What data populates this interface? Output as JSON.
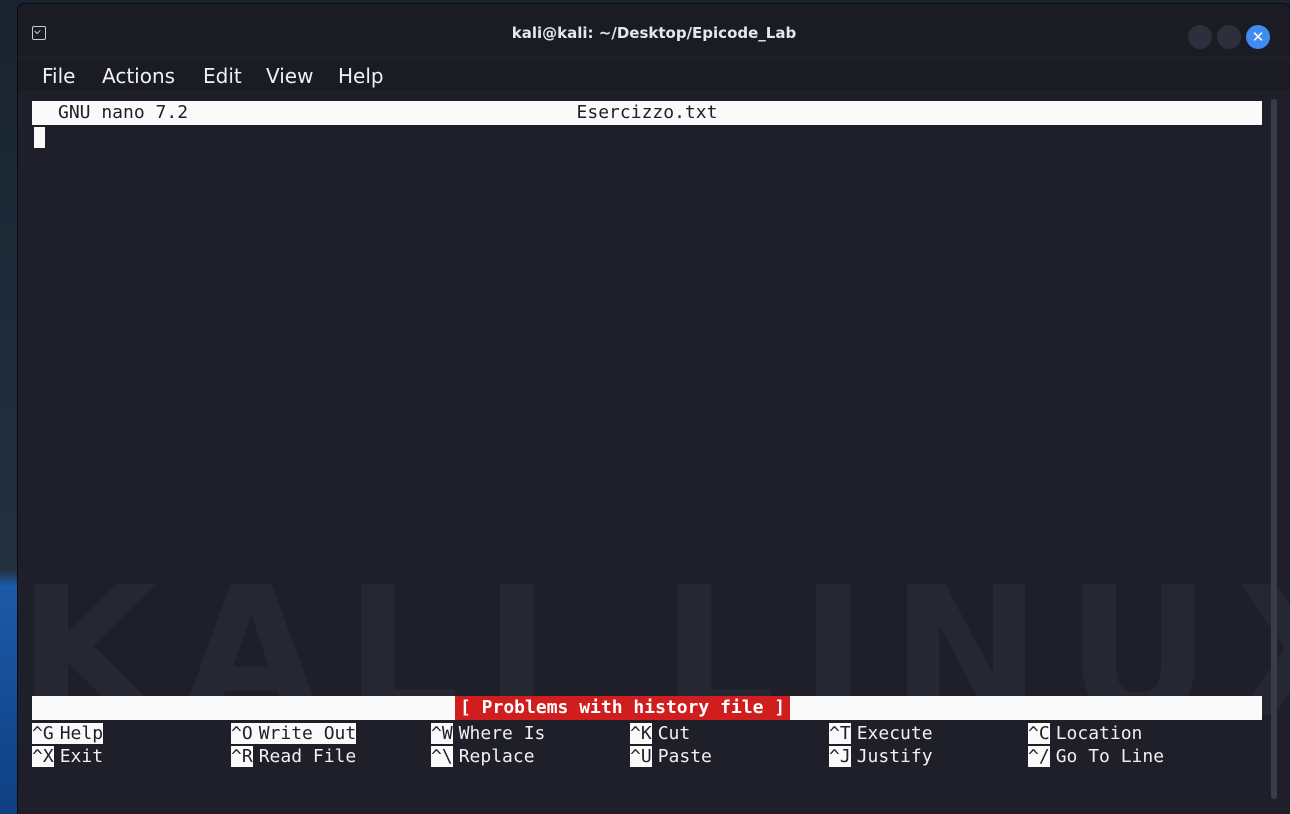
{
  "window": {
    "title": "kali@kali: ~/Desktop/Epicode_Lab",
    "close_symbol": "✕"
  },
  "menu": [
    "File",
    "Actions",
    "Edit",
    "View",
    "Help"
  ],
  "nano": {
    "version": "GNU nano 7.2",
    "filename": "Esercizzo.txt",
    "status_message": "[ Problems with history file ]",
    "shortcuts_row1": [
      {
        "key": "^G",
        "label": "Help"
      },
      {
        "key": "^O",
        "label": "Write Out"
      },
      {
        "key": "^W",
        "label": "Where Is"
      },
      {
        "key": "^K",
        "label": "Cut"
      },
      {
        "key": "^T",
        "label": "Execute"
      },
      {
        "key": "^C",
        "label": "Location"
      }
    ],
    "shortcuts_row2": [
      {
        "key": "^X",
        "label": "Exit"
      },
      {
        "key": "^R",
        "label": "Read File"
      },
      {
        "key": "^\\",
        "label": "Replace"
      },
      {
        "key": "^U",
        "label": "Paste"
      },
      {
        "key": "^J",
        "label": "Justify"
      },
      {
        "key": "^/",
        "label": "Go To Line"
      }
    ]
  },
  "watermark": "KALI LINUX",
  "colors": {
    "terminal_bg": "#1e1f29",
    "status_red": "#d01e1e",
    "close_blue": "#3f8bf0"
  }
}
